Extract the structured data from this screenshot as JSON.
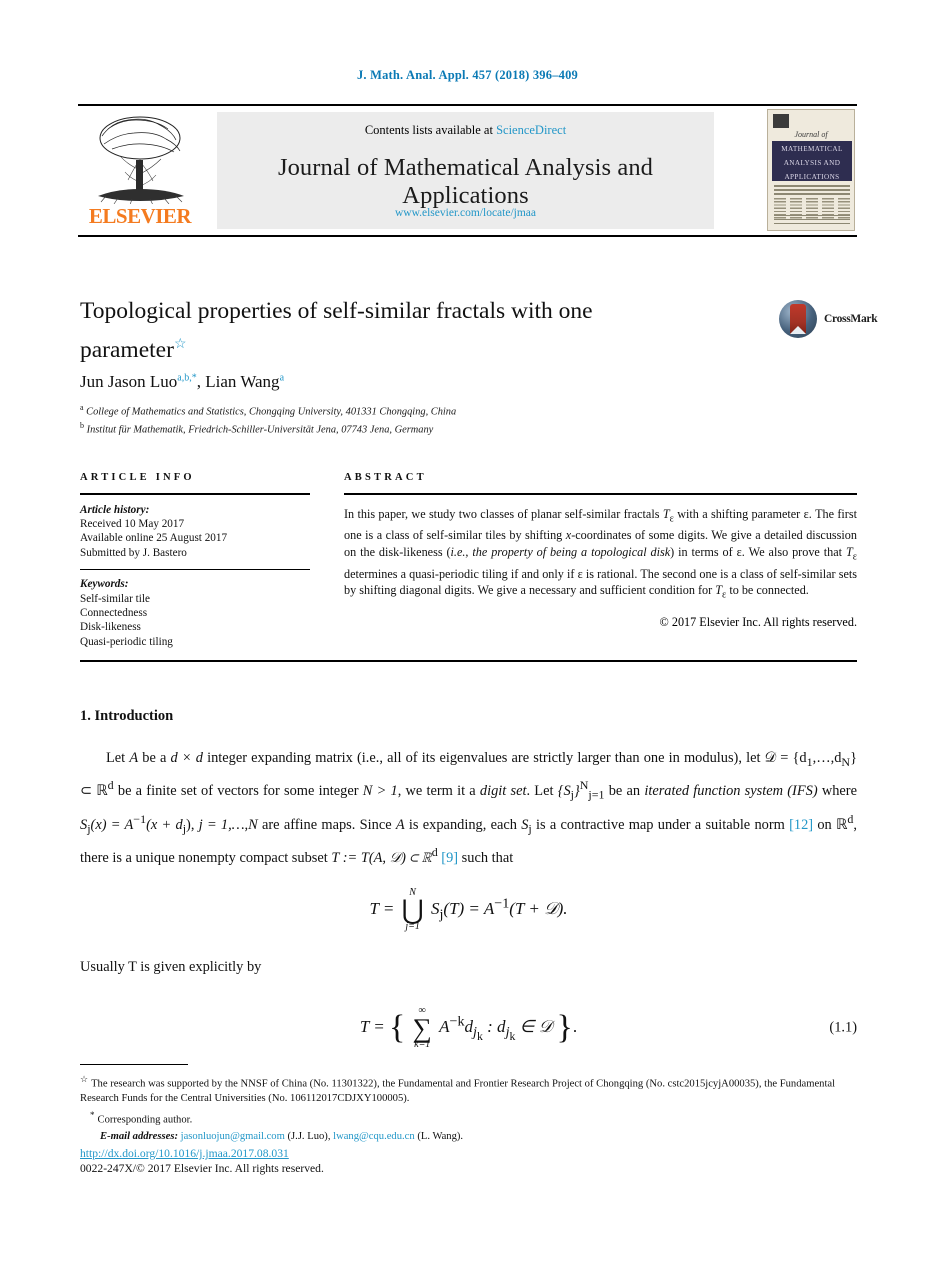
{
  "running_head": "J. Math. Anal. Appl. 457 (2018) 396–409",
  "masthead": {
    "contents_prefix": "Contents lists available at",
    "sciencedirect": "ScienceDirect",
    "journal_name": "Journal of Mathematical Analysis and Applications",
    "journal_url": "www.elsevier.com/locate/jmaa",
    "publisher": "ELSEVIER",
    "cover": {
      "journal_of": "Journal of",
      "band_line1": "MATHEMATICAL",
      "band_line2": "ANALYSIS AND",
      "band_line3": "APPLICATIONS"
    }
  },
  "article": {
    "title": "Topological properties of self-similar fractals with one parameter",
    "title_footnote_mark": "☆",
    "crossmark_label": "CrossMark",
    "authors": "Jun Jason Luo",
    "author1_sup": "a,b,*",
    "authors2": ", Lian Wang",
    "author2_sup": "a",
    "affiliation_a_mark": "a",
    "affiliation_a": "College of Mathematics and Statistics, Chongqing University, 401331 Chongqing, China",
    "affiliation_b_mark": "b",
    "affiliation_b": "Institut für Mathematik, Friedrich-Schiller-Universität Jena, 07743 Jena, Germany"
  },
  "info": {
    "heading": "ARTICLE INFO",
    "history_label": "Article history:",
    "received": "Received 10 May 2017",
    "available": "Available online 25 August 2017",
    "submitted": "Submitted by J. Bastero",
    "keywords_label": "Keywords:",
    "keywords": [
      "Self-similar tile",
      "Connectedness",
      "Disk-likeness",
      "Quasi-periodic tiling"
    ]
  },
  "abstract": {
    "heading": "ABSTRACT",
    "p1_a": "In this paper, we study two classes of planar self-similar fractals ",
    "p1_Te": "T",
    "p1_Te_sub": "ε",
    "p1_b": " with a shifting parameter ε. The first one is a class of self-similar tiles by shifting ",
    "p1_x": "x",
    "p1_c": "-coordinates of some digits. We give a detailed discussion on the disk-likeness (",
    "p1_ie": "i.e., the property of being a topological disk",
    "p1_d": ") in terms of ε. We also prove that ",
    "p1_Te2": "T",
    "p1_Te2_sub": "ε",
    "p1_e": " determines a quasi-periodic tiling if and only if ε is rational. The second one is a class of self-similar sets by shifting diagonal digits. We give a necessary and sufficient condition for ",
    "p1_Te3": "T",
    "p1_Te3_sub": "ε",
    "p1_f": " to be connected.",
    "copyright": "© 2017 Elsevier Inc. All rights reserved."
  },
  "body": {
    "section_heading": "1. Introduction",
    "para1_a": "Let ",
    "para1_A": "A",
    "para1_b": " be a ",
    "para1_dxd": "d × d",
    "para1_c": " integer expanding matrix (i.e., all of its eigenvalues are strictly larger than one in modulus), let ",
    "para1_D": "𝒟 = {d",
    "para1_D2": "1",
    "para1_D3": ",…,d",
    "para1_D4": "N",
    "para1_D5": "} ⊂ ℝ",
    "para1_D6": "d",
    "para1_d": " be a finite set of vectors for some integer ",
    "para1_N": "N > 1",
    "para1_e": ", we term it a ",
    "para1_digitset": "digit set",
    "para1_f": ". Let ",
    "para1_Sj": "{S",
    "para1_Sj2": "j",
    "para1_Sj3": "}",
    "para1_Sj4": "N",
    "para1_Sj5": "j=1",
    "para1_g": " be an ",
    "para1_ifs": "iterated function system (IFS)",
    "para1_h": " where ",
    "para1_eq": "S",
    "para1_eq_sub": "j",
    "para1_eq2": "(x) = A",
    "para1_eq2_sup": "−1",
    "para1_eq3": "(x + d",
    "para1_eq3_sub": "j",
    "para1_eq4": "), ",
    "para1_eq5": "j = 1,…,N",
    "para1_i": " are affine maps. Since ",
    "para1_A2": "A",
    "para1_j": " is expanding, each ",
    "para1_S2": "S",
    "para1_S2_sub": "j",
    "para1_k": " is a contractive map under a suitable norm ",
    "para1_ref12": "[12]",
    "para1_l": " on ℝ",
    "para1_l_sup": "d",
    "para1_m": ", there is a unique nonempty compact subset ",
    "para1_T": "T := T(A, 𝒟) ⊂ ℝ",
    "para1_T_sup": "d",
    "para1_ref9": "[9]",
    "para1_n": " such that",
    "eq1_lhs": "T =",
    "eq1_union_top": "N",
    "eq1_union_glyph": "⋃",
    "eq1_union_bot": "j=1",
    "eq1_mid": "S",
    "eq1_mid_sub": "j",
    "eq1_rhs": "(T) = A",
    "eq1_rhs_sup": "−1",
    "eq1_tail": "(T + 𝒟).",
    "para2": "Usually T is given explicitly by",
    "para2_T": "T",
    "eq2_lhs": "T =",
    "eq2_brace_l": "{",
    "eq2_sum_top": "∞",
    "eq2_sum_glyph": "∑",
    "eq2_sum_bot": "k=1",
    "eq2_body": "A",
    "eq2_body_sup": "−k",
    "eq2_body2": "d",
    "eq2_body2_sub": "j",
    "eq2_body2_sub2": "k",
    "eq2_colon": " : d",
    "eq2_colon_sub": "j",
    "eq2_colon_sub2": "k",
    "eq2_in": " ∈ 𝒟",
    "eq2_brace_r": "}",
    "eq2_period": ".",
    "eq2_number": "(1.1)"
  },
  "footnotes": {
    "star_mark": "☆",
    "funding": "The research was supported by the NNSF of China (No. 11301322), the Fundamental and Frontier Research Project of Chongqing (No. cstc2015jcyjA00035), the Fundamental Research Funds for the Central Universities (No. 106112017CDJXY100005).",
    "corresponding_mark": "*",
    "corresponding": "Corresponding author.",
    "email_label": "E-mail addresses:",
    "email1": "jasonluojun@gmail.com",
    "email1_name": "(J.J. Luo),",
    "email2": "lwang@cqu.edu.cn",
    "email2_name": "(L. Wang)."
  },
  "footer": {
    "doi": "http://dx.doi.org/10.1016/j.jmaa.2017.08.031",
    "issn": "0022-247X/© 2017 Elsevier Inc. All rights reserved."
  },
  "colors": {
    "link": "#2397c8",
    "runhead": "#0b7ab5",
    "elsevier_orange": "#f47b20",
    "cover_band": "#2e2d50"
  }
}
